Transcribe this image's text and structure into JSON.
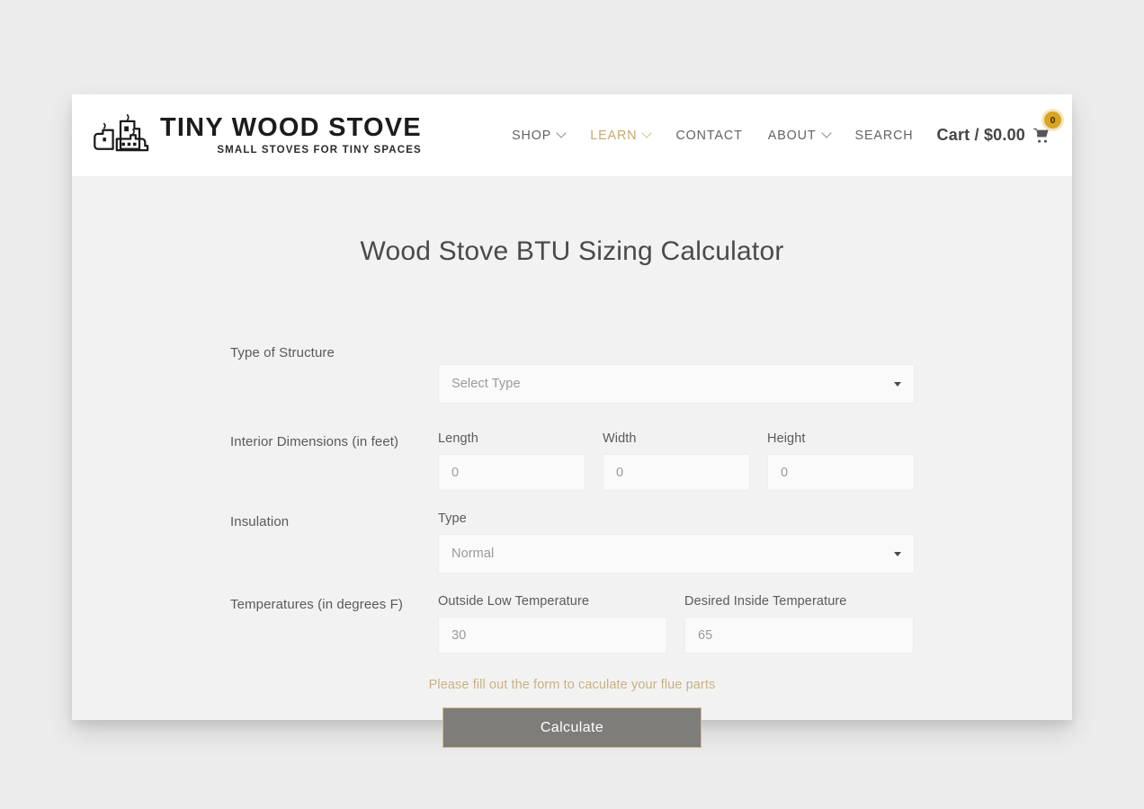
{
  "brand": {
    "name": "TINY WOOD STOVE",
    "tagline": "SMALL STOVES FOR TINY SPACES",
    "logo_icon": "tiny-houses-stove-logo"
  },
  "nav": {
    "items": [
      {
        "label": "SHOP",
        "has_dropdown": true,
        "active": false
      },
      {
        "label": "LEARN",
        "has_dropdown": true,
        "active": true
      },
      {
        "label": "CONTACT",
        "has_dropdown": false,
        "active": false
      },
      {
        "label": "ABOUT",
        "has_dropdown": true,
        "active": false
      },
      {
        "label": "SEARCH",
        "has_dropdown": false,
        "active": false
      }
    ],
    "cart": {
      "label": "Cart / $0.00",
      "count": "0",
      "icon": "shopping-cart-icon",
      "badge_color": "#d9a521"
    }
  },
  "page": {
    "title": "Wood Stove BTU Sizing Calculator"
  },
  "form": {
    "structure": {
      "row_label": "Type of Structure",
      "select_value": "Select Type"
    },
    "dimensions": {
      "row_label": "Interior Dimensions (in feet)",
      "fields": [
        {
          "label": "Length",
          "value": "0"
        },
        {
          "label": "Width",
          "value": "0"
        },
        {
          "label": "Height",
          "value": "0"
        }
      ]
    },
    "insulation": {
      "row_label": "Insulation",
      "field_label": "Type",
      "select_value": "Normal"
    },
    "temperatures": {
      "row_label": "Temperatures (in degrees F)",
      "fields": [
        {
          "label": "Outside Low Temperature",
          "value": "30"
        },
        {
          "label": "Desired Inside Temperature",
          "value": "65"
        }
      ]
    },
    "note": "Please fill out the form to caculate your flue parts",
    "submit_label": "Calculate",
    "accent_color": "#c8a86b"
  }
}
